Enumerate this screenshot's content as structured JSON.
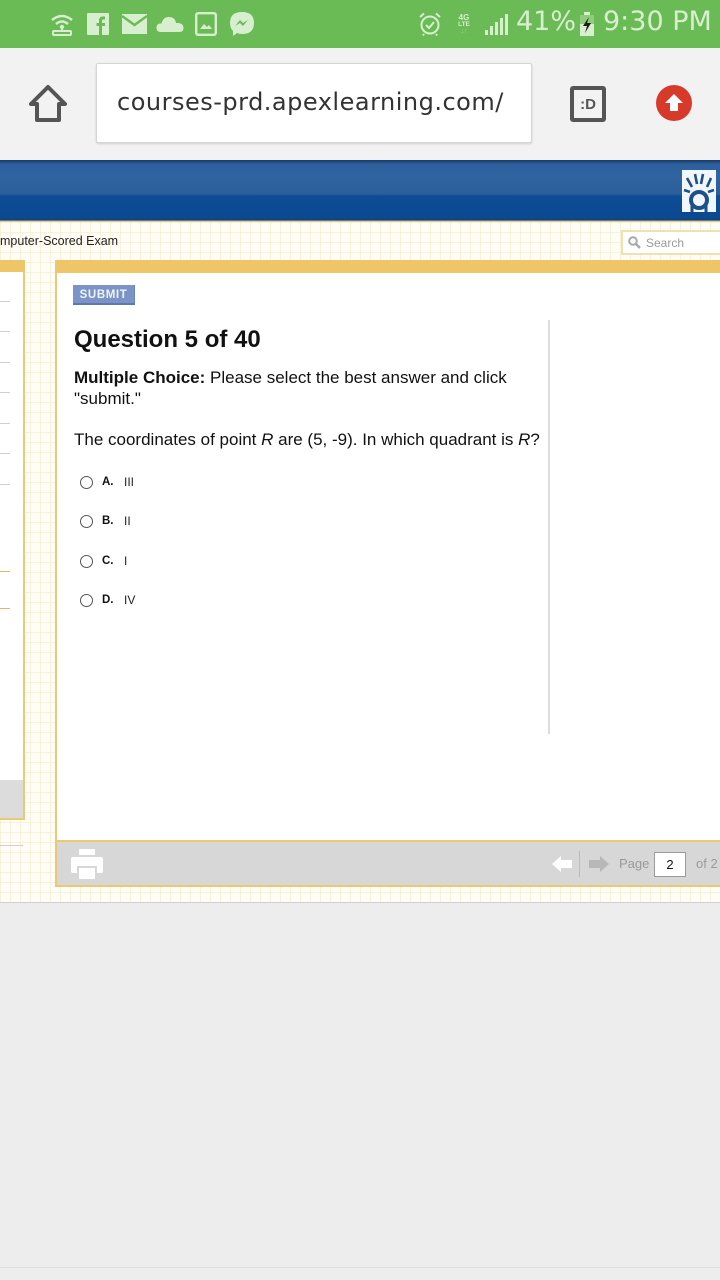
{
  "status_bar": {
    "notification_icons": [
      "wifi-hotspot-icon",
      "facebook-icon",
      "email-icon",
      "cloud-icon",
      "gallery-icon",
      "messenger-icon"
    ],
    "system_icons": [
      "alarm-icon",
      "4g-lte-icon",
      "signal-icon",
      "battery-charging-icon"
    ],
    "network_label_top": "4G",
    "network_label_bottom": "LTE",
    "battery_percent": "41%",
    "time": "9:30 PM",
    "background_color": "#6abb55"
  },
  "browser": {
    "url": "courses-prd.apexlearning.com/",
    "home_icon": "home-icon",
    "tabs_button_label": ":D",
    "update_icon": "upload-arrow-icon",
    "update_color": "#d7392b"
  },
  "site": {
    "header_color": "#0e4c95",
    "logo_icon": "apex-logo-icon",
    "breadcrumb": "mputer-Scored Exam",
    "search_placeholder": "Search"
  },
  "question": {
    "submit_label": "SUBMIT",
    "title": "Question 5 of 40",
    "instructions_bold": "Multiple Choice:",
    "instructions_rest": " Please select the best answer and click \"submit.\"",
    "prompt_part1": "The coordinates of point ",
    "prompt_var1": "R",
    "prompt_part2": " are (5, -9). In which quadrant is ",
    "prompt_var2": "R",
    "prompt_part3": "?",
    "choices": [
      {
        "letter": "A.",
        "text": "III",
        "selected": false
      },
      {
        "letter": "B.",
        "text": "II",
        "selected": false
      },
      {
        "letter": "C.",
        "text": "I",
        "selected": false
      },
      {
        "letter": "D.",
        "text": "IV",
        "selected": false
      }
    ]
  },
  "footer": {
    "page_label": "Page",
    "page_value": "2",
    "page_total": "of 2",
    "accent_color": "#ecc873"
  }
}
